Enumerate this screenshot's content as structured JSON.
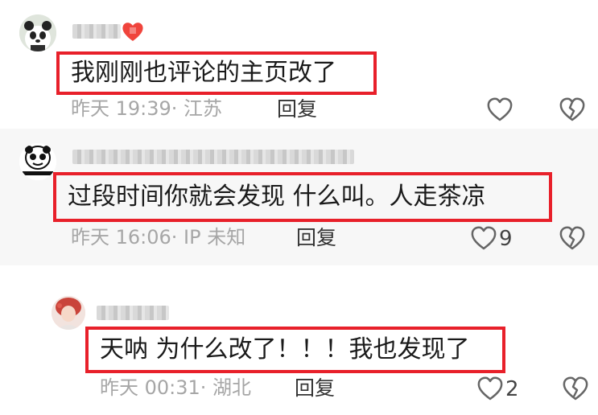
{
  "comments": [
    {
      "text": "我刚刚也评论的主页改了",
      "time": "昨天 19:39· 江苏",
      "reply_label": "回复",
      "like_count": ""
    },
    {
      "text": "过段时间你就会发现 什么叫。人走茶凉",
      "time": "昨天 16:06· IP 未知",
      "reply_label": "回复",
      "like_count": "9"
    },
    {
      "text": "天呐 为什么改了！！！我也发现了",
      "time": "昨天 00:31· 湖北",
      "reply_label": "回复",
      "like_count": "2"
    }
  ],
  "colors": {
    "highlight_border": "#e8202a",
    "meta_text": "#a6a6a6",
    "icon_stroke": "#666666"
  },
  "icons": [
    "panda-avatar",
    "meme-avatar",
    "user-photo-avatar",
    "heart-badge-icon",
    "like-heart-icon",
    "dislike-broken-heart-icon"
  ]
}
